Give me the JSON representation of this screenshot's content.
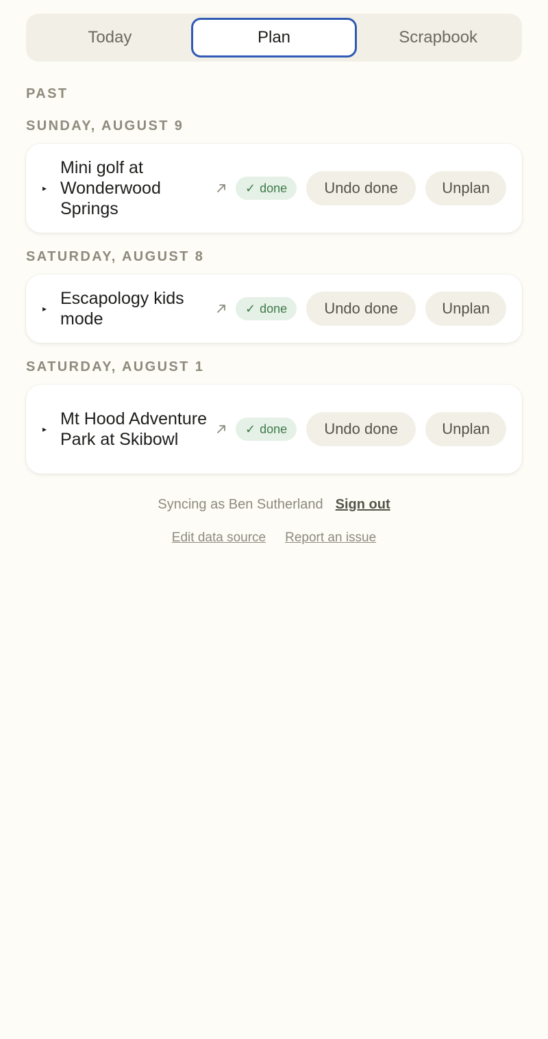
{
  "tabs": [
    {
      "label": "Today",
      "active": false
    },
    {
      "label": "Plan",
      "active": true
    },
    {
      "label": "Scrapbook",
      "active": false
    }
  ],
  "past_label": "PAST",
  "days": [
    {
      "date": "SUNDAY, AUGUST 9",
      "title": "Mini golf at Wonderwood Springs",
      "status": "done",
      "undo_label": "Undo done",
      "unplan_label": "Unplan"
    },
    {
      "date": "SATURDAY, AUGUST 8",
      "title": "Escapology kids mode",
      "status": "done",
      "undo_label": "Undo done",
      "unplan_label": "Unplan"
    },
    {
      "date": "SATURDAY, AUGUST 1",
      "title": "Mt Hood Adventure Park at Skibowl",
      "status": "done",
      "undo_label": "Undo done",
      "unplan_label": "Unplan"
    }
  ],
  "footer": {
    "sync_text": "Syncing as Ben Sutherland",
    "sign_out": "Sign out",
    "edit_data_source": "Edit data source",
    "report_issue": "Report an issue"
  },
  "icons": {
    "expand": "triangle-right-icon",
    "external_link": "arrow-up-right-icon",
    "check": "check-icon"
  },
  "colors": {
    "background": "#fdfcf6",
    "active_tab_border": "#2f5ab5",
    "done_badge_bg": "#e5f1e6",
    "done_badge_text": "#3f7a4a"
  }
}
